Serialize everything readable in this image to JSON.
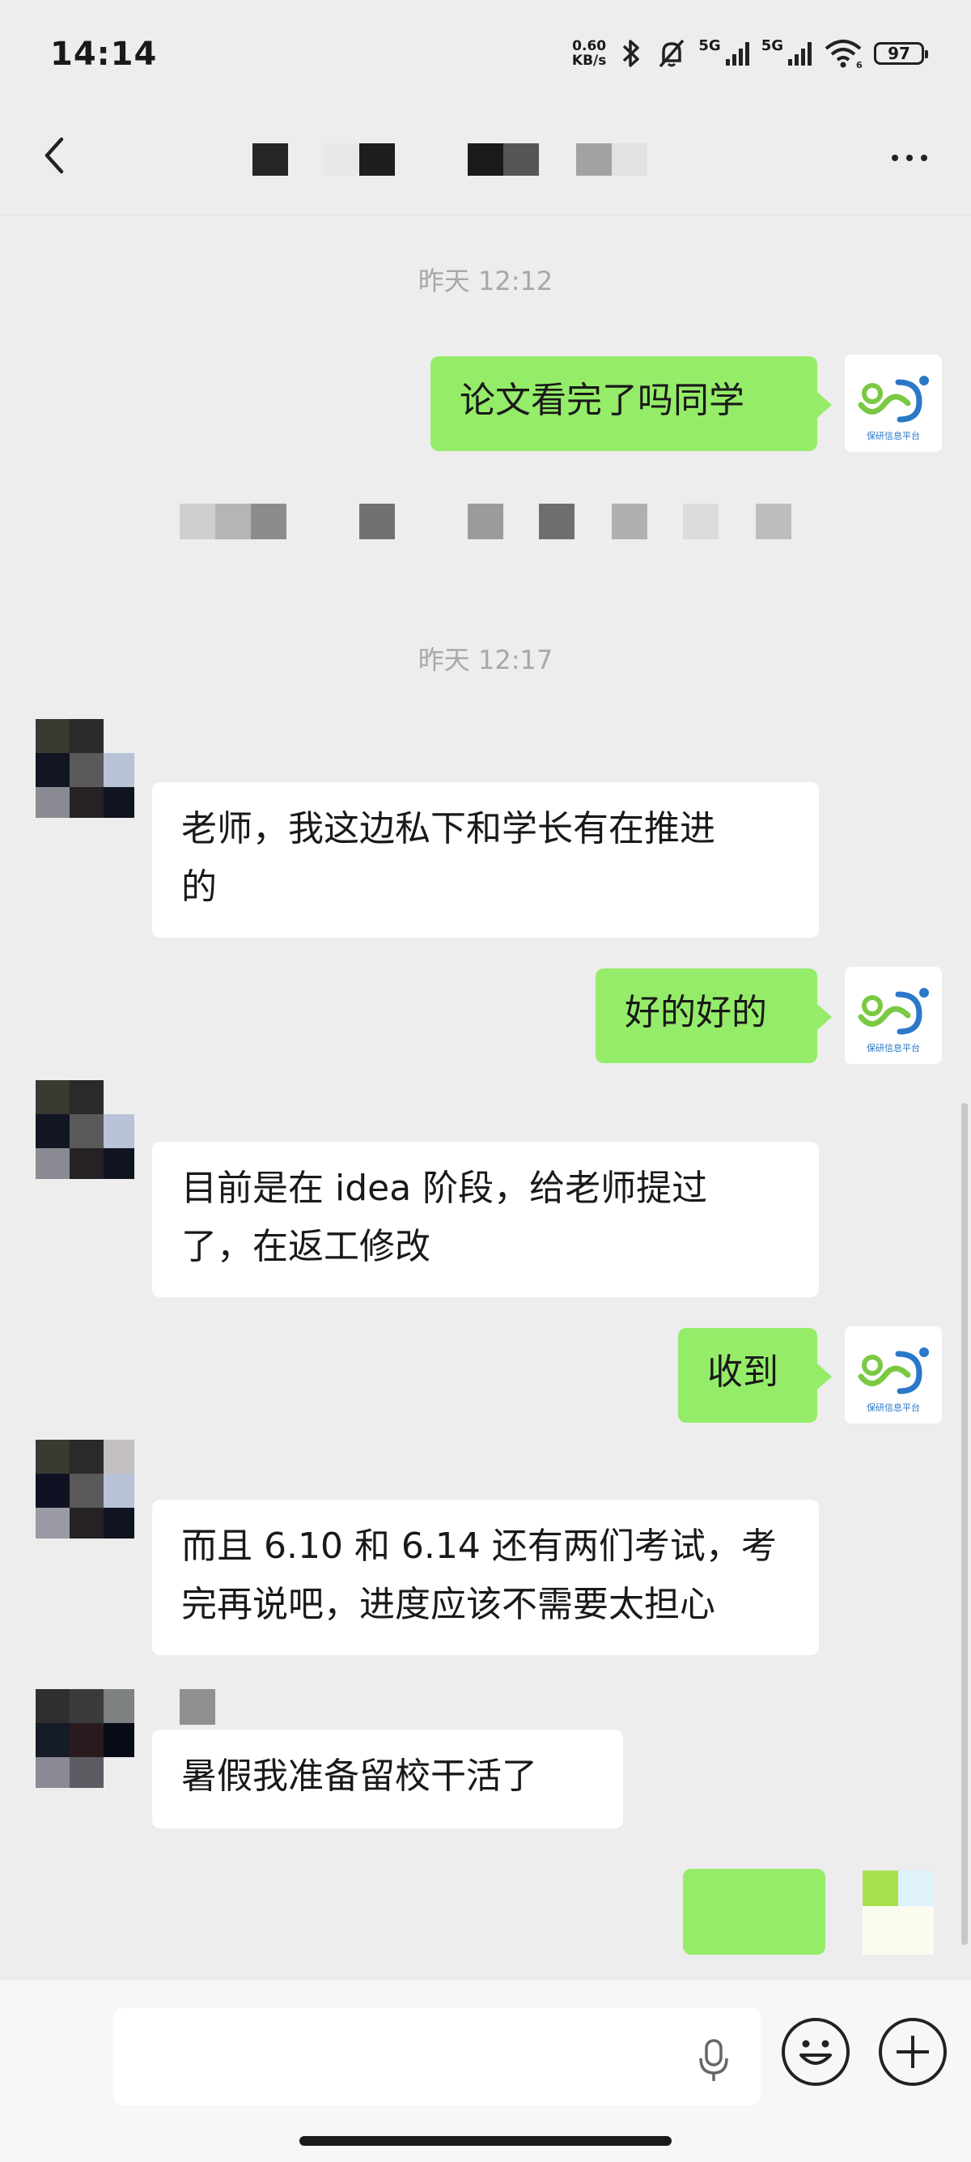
{
  "status_bar": {
    "time": "14:14",
    "net_speed_value": "0.60",
    "net_speed_unit": "KB/s",
    "signal1_label": "5G",
    "signal2_label": "5G",
    "wifi_badge": "6",
    "battery": "97"
  },
  "nav": {
    "title_redacted": true
  },
  "messages": [
    {
      "type": "time",
      "text": "昨天 12:12"
    },
    {
      "type": "me",
      "text": "论文看完了吗同学"
    },
    {
      "type": "redacted"
    },
    {
      "type": "time",
      "text": "昨天 12:17"
    },
    {
      "type": "them",
      "lines": [
        "老师，我这边私下和学长有在推进",
        "的"
      ]
    },
    {
      "type": "me",
      "text": "好的好的"
    },
    {
      "type": "them",
      "lines": [
        "目前是在 idea 阶段，给老师提过",
        "了，在返工修改"
      ]
    },
    {
      "type": "me",
      "text": "收到"
    },
    {
      "type": "them",
      "lines": [
        "而且 6.10 和 6.14 还有两们考试，考",
        "完再说吧，进度应该不需要太担心"
      ]
    },
    {
      "type": "them",
      "lines": [
        "暑假我准备留校干活了"
      ]
    },
    {
      "type": "me",
      "text": ""
    }
  ],
  "platform_avatar_caption": "保研信息平台",
  "colors": {
    "me_bubble": "#95ec69",
    "background": "#ededed",
    "logo_green": "#7ac943",
    "logo_blue": "#2a78c8"
  },
  "input": {
    "placeholder": ""
  }
}
